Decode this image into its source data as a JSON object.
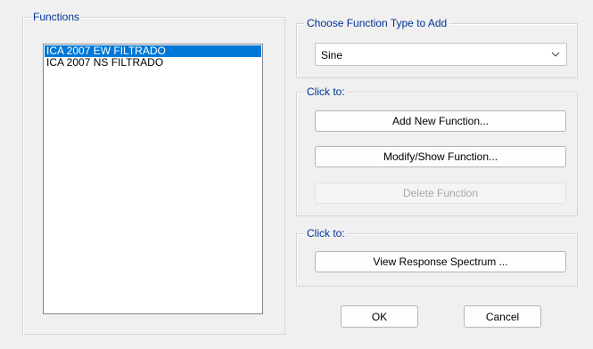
{
  "functions_panel": {
    "title": "Functions",
    "items": [
      {
        "label": "ICA 2007 EW FILTRADO",
        "selected": true
      },
      {
        "label": "ICA 2007 NS FILTRADO",
        "selected": false
      }
    ]
  },
  "function_type": {
    "title": "Choose  Function Type to Add",
    "selected": "Sine",
    "arrow_icon": "chevron-down-icon"
  },
  "actions": {
    "title": "Click to:",
    "add_label": "Add New Function...",
    "modify_label": "Modify/Show Function...",
    "delete_label": "Delete Function",
    "delete_enabled": false
  },
  "spectrum": {
    "title": "Click to:",
    "view_label": "View Response Spectrum ..."
  },
  "dialog": {
    "ok_label": "OK",
    "cancel_label": "Cancel"
  },
  "colors": {
    "background": "#f0f0f0",
    "group_title": "#003399",
    "selection": "#0078d7",
    "disabled_text": "#a8a8a8"
  }
}
